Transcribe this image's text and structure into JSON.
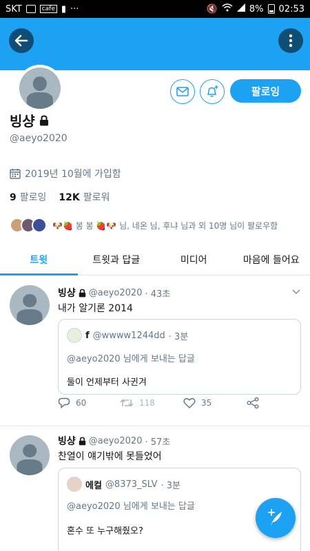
{
  "status_bar": {
    "carrier": "SKT",
    "cafe": "cafe",
    "battery": "8%",
    "time": "02:53"
  },
  "colors": {
    "accent": "#1da1f2",
    "header": "#1da1f2",
    "dark_button": "#0e4e74"
  },
  "profile": {
    "name": "빙샹",
    "handle": "@aeyo2020",
    "joined": "2019년 10월에 가입함",
    "following_count": "9",
    "following_label": "팔로잉",
    "followers_count": "12K",
    "followers_label": "팔로워",
    "followed_by": "🐶🍓 봉 봉 🍓🐶 님, 네온 님, 후냐 님과 외 10명 님이 팔로우함",
    "follow_button": "팔로잉"
  },
  "tabs": [
    {
      "label": "트윗",
      "active": true
    },
    {
      "label": "트윗과 답글",
      "active": false
    },
    {
      "label": "미디어",
      "active": false
    },
    {
      "label": "마음에 들어요",
      "active": false
    }
  ],
  "tweets": [
    {
      "name": "빙샹",
      "handle": "@aeyo2020",
      "time": "· 43초",
      "text": "내가 알기론 2014",
      "quote": {
        "name": "f",
        "handle": "@wwww1244dd",
        "time": "· 3분",
        "reply_to_handle": "@aeyo2020",
        "reply_to_suffix": "님에게 보내는 답글",
        "text": "둘이 언제부터 사귄겨"
      },
      "replies": "60",
      "retweets": "118",
      "likes": "35"
    },
    {
      "name": "빙샹",
      "handle": "@aeyo2020",
      "time": "· 57초",
      "text": "찬열이 얘기밖에 못들었어",
      "quote": {
        "name": "에컬",
        "handle": "@8373_SLV",
        "time": "· 3분",
        "reply_to_handle": "@aeyo2020",
        "reply_to_suffix": "님에게 보내는 답글",
        "text": "혼수 또 누구해줬오?"
      }
    }
  ],
  "icons": {
    "back": "arrow-left-icon",
    "more": "more-vertical-icon",
    "message": "envelope-icon",
    "notify": "bell-plus-icon",
    "lock": "lock-icon",
    "calendar": "calendar-icon",
    "reply": "reply-icon",
    "retweet": "retweet-icon",
    "like": "heart-icon",
    "share": "share-icon",
    "compose": "compose-feather-icon"
  }
}
